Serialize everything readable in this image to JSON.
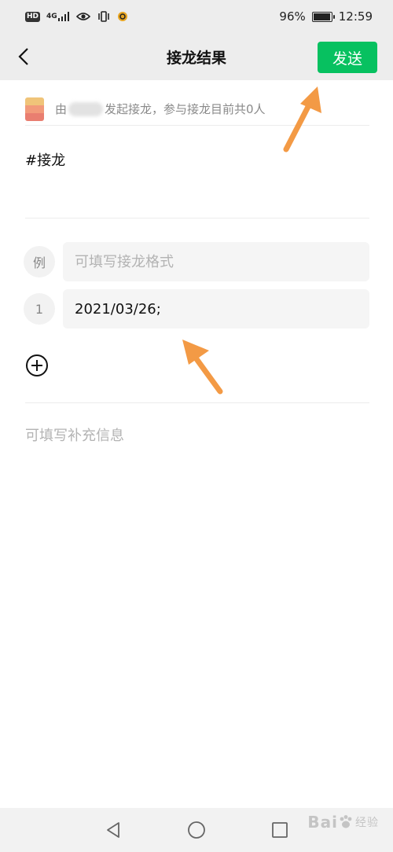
{
  "status_bar": {
    "hd": "HD",
    "network": "4G",
    "battery": "96%",
    "battery_level": 0.96,
    "time": "12:59"
  },
  "nav": {
    "title": "接龙结果",
    "send_label": "发送",
    "back_icon": "chevron-left-icon"
  },
  "initiator": {
    "prefix": "由",
    "suffix": "发起接龙，参与接龙目前共0人"
  },
  "hashtag": "#接龙",
  "entries": {
    "example": {
      "index": "例",
      "placeholder": "可填写接龙格式"
    },
    "rows": [
      {
        "index": "1",
        "value": "2021/03/26;"
      }
    ]
  },
  "add_icon": "plus-circle-icon",
  "supplement_placeholder": "可填写补充信息",
  "watermark": {
    "text": "Bai",
    "suffix": "经验"
  },
  "colors": {
    "accent": "#07c160",
    "header_bg": "#ededed",
    "arrow": "#f39a45"
  }
}
